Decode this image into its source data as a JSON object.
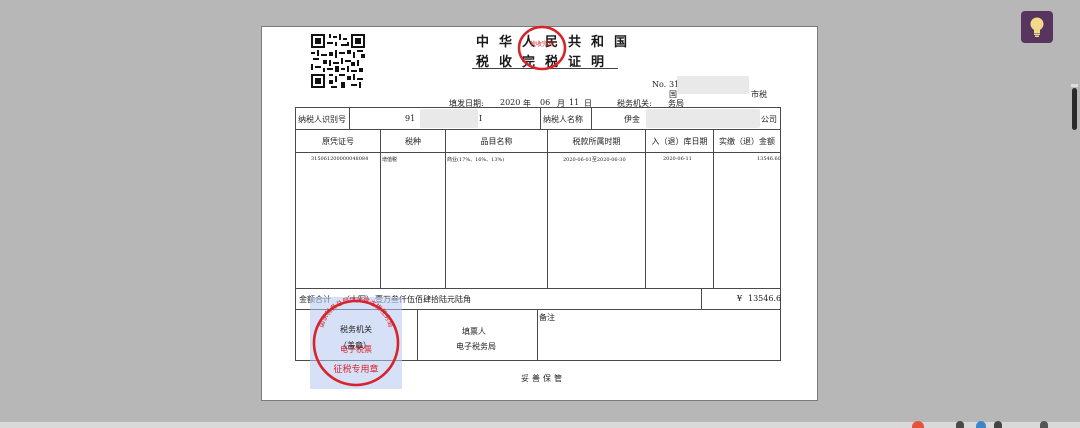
{
  "header": {
    "title_line1": "中华人民共和国",
    "title_line2": "税收完税证明",
    "no_label": "No.",
    "no_value": "31",
    "tax_office_fragment": "国",
    "tax_office_suffix": "市税",
    "fill_date_label": "填发日期:",
    "fill_year": "2020",
    "year_unit": "年",
    "fill_month": "06",
    "month_unit": "月",
    "fill_day": "11",
    "day_unit": "日",
    "tax_authority_label": "税务机关:",
    "tax_authority_value": "务局"
  },
  "taxpayer": {
    "id_label": "纳税人识别号",
    "id_value": "91",
    "id_suffix": "I",
    "name_label": "纳税人名称",
    "name_prefix": "伊金",
    "name_suffix": "公司"
  },
  "table": {
    "headers": [
      "原凭证号",
      "税种",
      "品目名称",
      "税款所属时期",
      "入（退）库日期",
      "实缴（退）金额"
    ],
    "rows": [
      [
        "315061200000048084",
        "增值税",
        "商业(17%、16%、13%)",
        "2020-06-01至2020-06-30",
        "2020-06-11",
        "13546.60"
      ]
    ]
  },
  "total": {
    "label": "金额合计",
    "upper_label": "（大写）",
    "upper_value": "壹万叁仟伍佰肆拾陆元陆角",
    "symbol": "¥",
    "value": "13546.6"
  },
  "footer": {
    "authority_line1": "税务机关",
    "authority_line2": "（盖章）",
    "filler_label": "填票人",
    "filler_value": "电子税务局",
    "remark_label": "备注",
    "keep_note": "妥善保管"
  },
  "seals": {
    "top_text": "税收完税",
    "big_inner1": "电子税票",
    "big_inner2": "征税专用章",
    "big_ring": "国家税务总局伊金霍洛旗税务局"
  },
  "colors": {
    "seal_red": "#d8232a",
    "paper": "#ffffff",
    "background": "#b7b7b7",
    "idea_button": "#57355f",
    "bulb": "#f3d98a"
  },
  "icons": {
    "idea_button": "lightbulb-icon"
  }
}
